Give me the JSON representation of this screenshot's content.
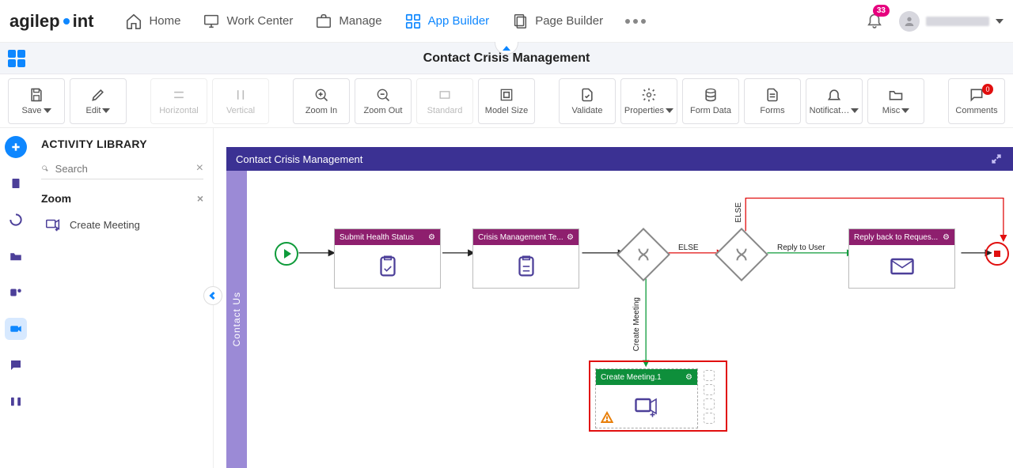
{
  "brand": {
    "name_a": "agilep",
    "name_b": "int"
  },
  "nav": {
    "items": [
      {
        "label": "Home",
        "active": false
      },
      {
        "label": "Work Center",
        "active": false
      },
      {
        "label": "Manage",
        "active": false
      },
      {
        "label": "App Builder",
        "active": true
      },
      {
        "label": "Page Builder",
        "active": false
      }
    ],
    "notifications_count": "33",
    "user_name": "██████████"
  },
  "page": {
    "title": "Contact Crisis Management"
  },
  "toolbar": {
    "save": "Save",
    "edit": "Edit",
    "horizontal": "Horizontal",
    "vertical": "Vertical",
    "zoom_in": "Zoom In",
    "zoom_out": "Zoom Out",
    "standard": "Standard",
    "model_size": "Model Size",
    "validate": "Validate",
    "properties": "Properties",
    "form_data": "Form Data",
    "forms": "Forms",
    "notifications": "Notificat…",
    "misc": "Misc",
    "comments": "Comments",
    "comments_count": "0"
  },
  "sidebar": {
    "heading": "ACTIVITY LIBRARY",
    "search_placeholder": "Search",
    "category": "Zoom",
    "items": [
      {
        "label": "Create Meeting"
      }
    ]
  },
  "canvas": {
    "header": "Contact Crisis Management",
    "contact_tab": "Contact Us",
    "nodes": {
      "submit": "Submit Health Status",
      "crisis": "Crisis Management Te...",
      "reply": "Reply back to Reques...",
      "create": "Create Meeting.1"
    },
    "edges": {
      "else1": "ELSE",
      "else2": "ELSE",
      "reply_to_user": "Reply to User",
      "create_meeting": "Create Meeting"
    }
  }
}
